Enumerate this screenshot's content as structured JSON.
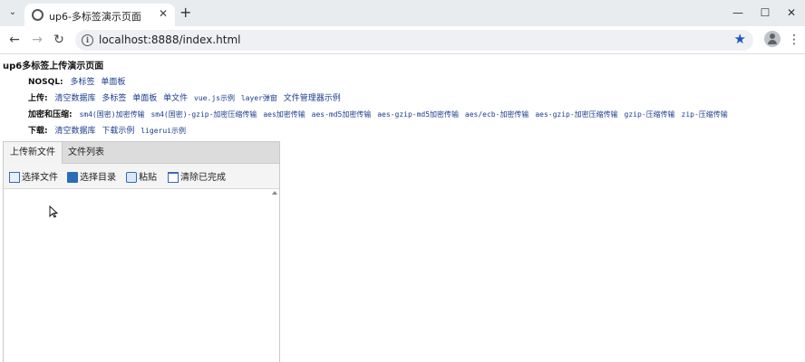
{
  "browser": {
    "tab_title": "up6-多标签演示页面",
    "url": "localhost:8888/index.html"
  },
  "page": {
    "title": "up6多标签上传演示页面",
    "rows": [
      {
        "label": "NOSQL:",
        "links": [
          "多标签",
          "单面板"
        ]
      },
      {
        "label": "上传:",
        "links": [
          "清空数据库",
          "多标签",
          "单面板",
          "单文件",
          "vue.js示例",
          "layer弹窗",
          "文件管理器示例"
        ]
      },
      {
        "label": "加密和压缩:",
        "links": [
          "sm4(国密)加密传输",
          "sm4(国密)-gzip-加密压缩传输",
          "aes加密传输",
          "aes-md5加密传输",
          "aes-gzip-md5加密传输",
          "aes/ecb-加密传输",
          "aes-gzip-加密压缩传输",
          "gzip-压缩传输",
          "zip-压缩传输"
        ]
      },
      {
        "label": "下载:",
        "links": [
          "清空数据库",
          "下载示例",
          "ligerui示例"
        ]
      }
    ]
  },
  "panel": {
    "tabs": [
      "上传新文件",
      "文件列表"
    ],
    "toolbar": {
      "select_file": "选择文件",
      "select_dir": "选择目录",
      "paste": "粘贴",
      "clear_done": "清除已完成"
    }
  }
}
